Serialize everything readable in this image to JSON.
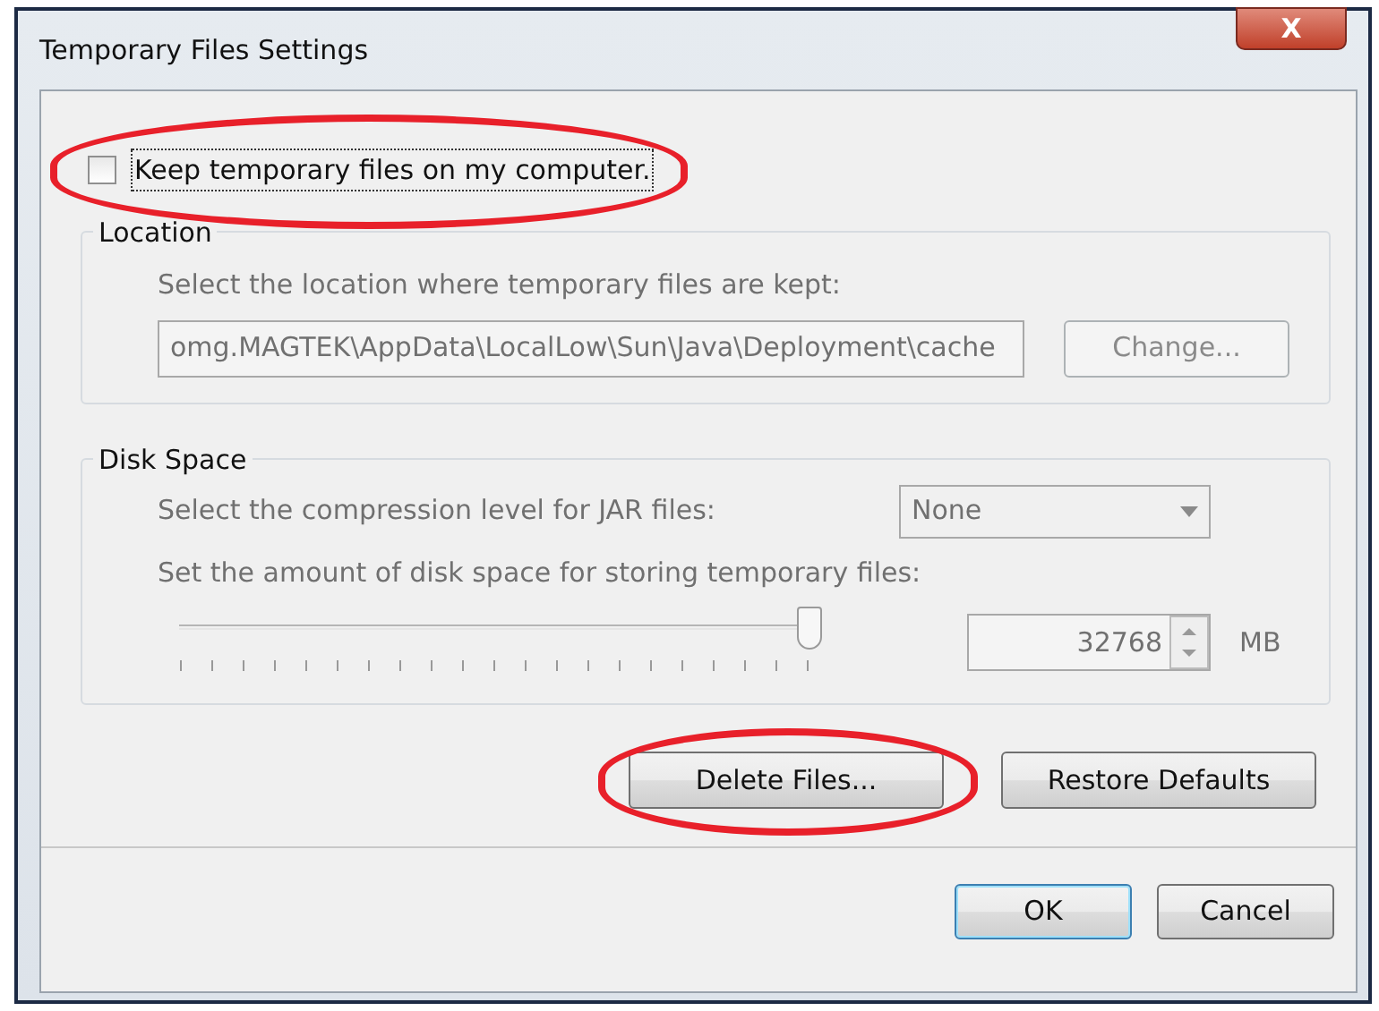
{
  "window": {
    "title": "Temporary Files Settings",
    "close": "X"
  },
  "keep_files": {
    "label": "Keep temporary files on my computer.",
    "checked": false,
    "highlighted": true
  },
  "location": {
    "legend": "Location",
    "prompt": "Select the location where temporary files are kept:",
    "path": "omg.MAGTEK\\AppData\\LocalLow\\Sun\\Java\\Deployment\\cache",
    "button": "Change...",
    "disabled": true
  },
  "disk_space": {
    "legend": "Disk Space",
    "compression_label": "Select the compression level for JAR files:",
    "compression": "None",
    "amount_label": "Set the amount of disk space for storing temporary files:",
    "level": 1,
    "amount": "32768",
    "unit": "MB",
    "disabled": true
  },
  "actions": [
    {
      "label": "Delete Files...",
      "highlighted": true
    },
    {
      "label": "Restore Defaults",
      "highlighted": false
    }
  ],
  "buttons": [
    {
      "label": "OK",
      "default": true
    },
    {
      "label": "Cancel",
      "default": false
    }
  ]
}
